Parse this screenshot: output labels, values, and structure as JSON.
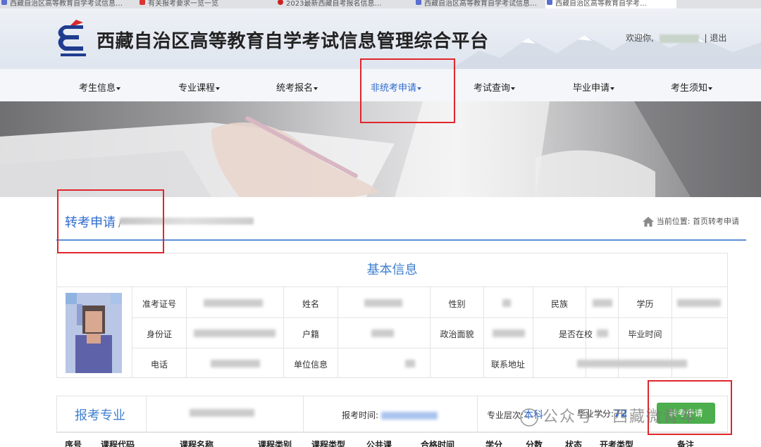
{
  "browser_tabs": [
    "西藏自治区高等教育自学考试信息…",
    "有关报考要求一览一览",
    "2023最新西藏自考报名信息…",
    "西藏自治区高等教育自学考试信息…",
    "西藏自治区高等教育自学考…"
  ],
  "header": {
    "site_title": "西藏自治区高等教育自学考试信息管理综合平台",
    "welcome": "欢迎你,",
    "separator": "|",
    "logout": "退出"
  },
  "nav": {
    "items": [
      "考生信息",
      "专业课程",
      "统考报名",
      "非统考申请",
      "考试查询",
      "毕业申请",
      "考生须知"
    ],
    "active_index": 3
  },
  "section": {
    "title": "转考申请",
    "slash": "/",
    "breadcrumb": "当前位置: 首页转考申请"
  },
  "basic_info": {
    "title": "基本信息",
    "labels": {
      "admission_no": "准考证号",
      "name": "姓名",
      "gender": "性别",
      "ethnicity": "民族",
      "education": "学历",
      "id_card": "身份证",
      "household": "户籍",
      "political": "政治面貌",
      "in_school": "是否在校",
      "grad_time": "毕业时间",
      "phone": "电话",
      "employer": "单位信息",
      "address": "联系地址"
    }
  },
  "major": {
    "title": "报考专业",
    "exam_time_label": "报考时间:",
    "level_label": "专业层次:",
    "level_value": "本科",
    "credits_label": "毕业学分:",
    "credits_value": "72",
    "apply_button": "转考申请"
  },
  "table": {
    "headers": [
      "序号",
      "课程代码",
      "课程名称",
      "课程类别",
      "课程类型",
      "公共课",
      "合格时间",
      "学分",
      "分数",
      "状态",
      "开考类型",
      "备注"
    ]
  },
  "watermark": "公众号 · 西藏微青年",
  "colors": {
    "accent": "#2d6bd0",
    "annotation": "#e0262b",
    "button": "#4cae4c"
  }
}
